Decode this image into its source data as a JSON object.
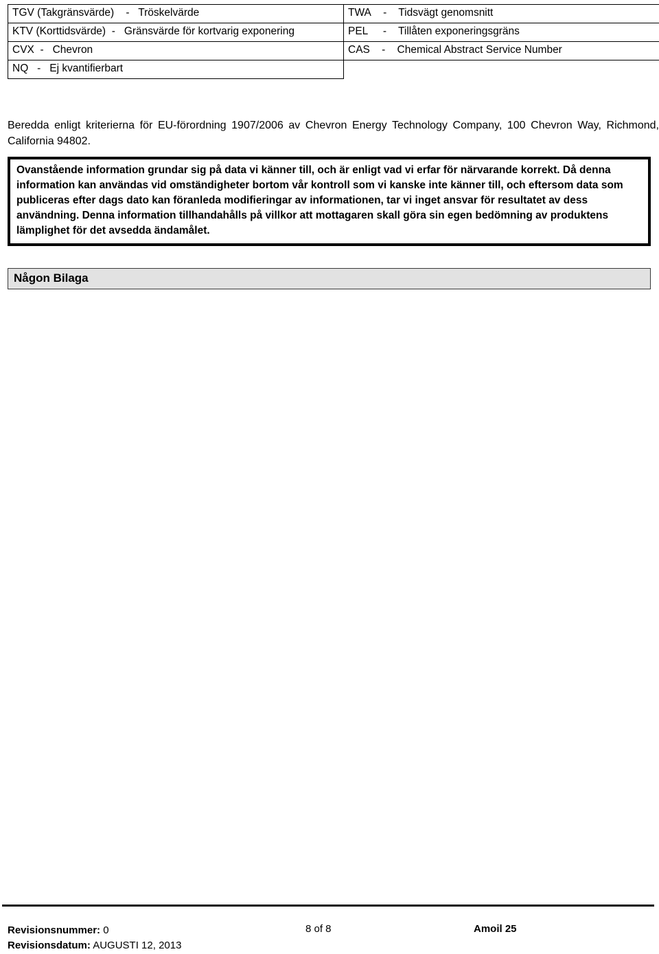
{
  "abbreviation_table": {
    "rows": [
      {
        "left": {
          "code": "TGV (Takgränsvärde)",
          "dash": "-",
          "term": "Tröskelvärde"
        },
        "right": {
          "code": "TWA",
          "dash": "-",
          "term": "Tidsvägt genomsnitt"
        }
      },
      {
        "left": {
          "code": "KTV (Korttidsvärde)",
          "dash": "-",
          "term": "Gränsvärde för kortvarig exponering"
        },
        "right": {
          "code": "PEL",
          "dash": "-",
          "term": "Tillåten exponeringsgräns"
        }
      },
      {
        "left": {
          "code": "CVX",
          "dash": "-",
          "term": "Chevron"
        },
        "right": {
          "code": "CAS",
          "dash": "-",
          "term": "Chemical Abstract Service Number"
        }
      },
      {
        "left": {
          "code": "NQ",
          "dash": "-",
          "term": "Ej kvantifierbart"
        },
        "right": null
      }
    ]
  },
  "prepared_by": {
    "text": "Beredda enligt kriterierna för EU-förordning 1907/2006 av Chevron Energy Technology Company, 100 Chevron Way, Richmond, California 94802."
  },
  "disclaimer": {
    "text": "Ovanstående information grundar sig på data vi känner till, och är enligt vad vi erfar för närvarande korrekt.  Då denna information kan användas vid omständigheter bortom vår kontroll som vi kanske inte känner till, och eftersom data som publiceras efter dags dato kan föranleda modifieringar av informationen, tar vi inget ansvar för resultatet av dess användning.  Denna information tillhandahålls på villkor att mottagaren skall göra sin egen bedömning av produktens lämplighet för det avsedda ändamålet."
  },
  "appendix": {
    "title": "Någon Bilaga"
  },
  "footer": {
    "revision_number_label": "Revisionsnummer:",
    "revision_number_value": "0",
    "revision_date_label": "Revisionsdatum:",
    "revision_date_value": "AUGUSTI 12, 2013",
    "page_indicator": "8 of 8",
    "product_name": "Amoil 25"
  },
  "colors": {
    "text": "#000000",
    "rule": "#0a0a0a",
    "appendix_background": "#e2e2e2",
    "appendix_border": "#3a3a3a"
  }
}
